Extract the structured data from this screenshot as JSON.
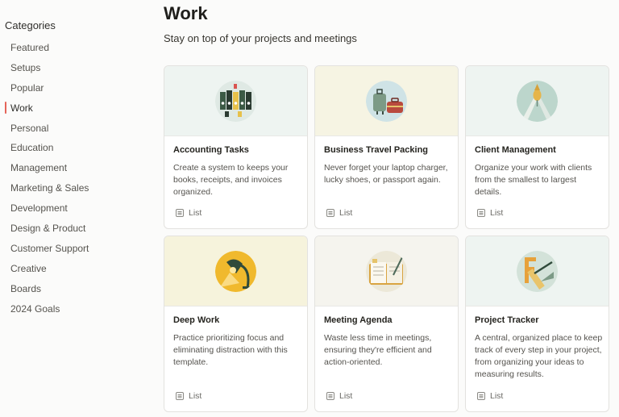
{
  "sidebar": {
    "heading": "Categories",
    "items": [
      {
        "label": "Featured"
      },
      {
        "label": "Setups"
      },
      {
        "label": "Popular"
      },
      {
        "label": "Work"
      },
      {
        "label": "Personal"
      },
      {
        "label": "Education"
      },
      {
        "label": "Management"
      },
      {
        "label": "Marketing & Sales"
      },
      {
        "label": "Development"
      },
      {
        "label": "Design & Product"
      },
      {
        "label": "Customer Support"
      },
      {
        "label": "Creative"
      },
      {
        "label": "Boards"
      },
      {
        "label": "2024 Goals"
      }
    ],
    "active_item": "Work"
  },
  "main": {
    "title": "Work",
    "subtitle": "Stay on top of your projects and meetings"
  },
  "cards": [
    {
      "title": "Accounting Tasks",
      "description": "Create a system to keeps your books, receipts, and invoices organized.",
      "type": "List",
      "art_bg": "#eef4f1",
      "icon": "binders-icon"
    },
    {
      "title": "Business Travel Packing",
      "description": "Never forget your laptop charger, lucky shoes, or passport again.",
      "type": "List",
      "art_bg": "#f6f4e3",
      "icon": "luggage-icon"
    },
    {
      "title": "Client Management",
      "description": "Organize your work with clients from the smallest to largest details.",
      "type": "List",
      "art_bg": "#eef4f1",
      "icon": "handshake-icon"
    },
    {
      "title": "Deep Work",
      "description": "Practice prioritizing focus and eliminating distraction with this template.",
      "type": "List",
      "art_bg": "#f6f3dc",
      "icon": "desk-lamp-icon"
    },
    {
      "title": "Meeting Agenda",
      "description": "Waste less time in meetings, ensuring they're efficient and action-oriented.",
      "type": "List",
      "art_bg": "#f5f4ee",
      "icon": "notebook-icon"
    },
    {
      "title": "Project Tracker",
      "description": "A central, organized place to keep track of every step in your project, from organizing your ideas to measuring results.",
      "type": "List",
      "art_bg": "#eef4f1",
      "icon": "drafting-tools-icon"
    }
  ]
}
